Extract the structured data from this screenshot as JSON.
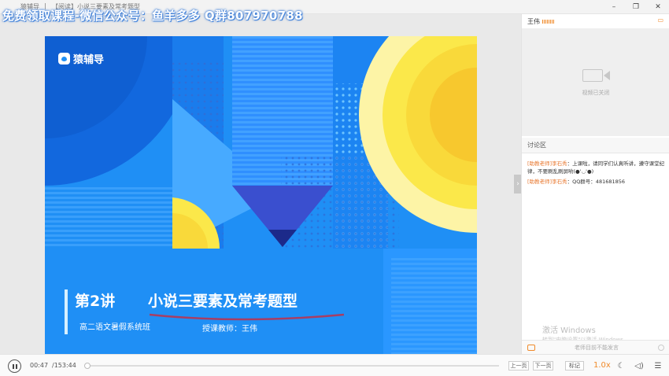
{
  "watermark": {
    "text": "免费领取课程-微信公众号：鱼羊多多 Q群807970788"
  },
  "titlebar": {
    "app_name": "猿辅导",
    "separator": "|",
    "breadcrumb": "【阅读】小说三要素及常考题型",
    "controls": {
      "minimize": "–",
      "maximize": "❐",
      "close": "✕"
    }
  },
  "slide": {
    "logo_text": "猿辅导",
    "lecture_number": "第2讲",
    "lecture_title": "小说三要素及常考题型",
    "course_name": "高二语文暑假系统班",
    "teacher_label": "授课教师：王伟",
    "colors": {
      "background": "#1f8ff5",
      "accent_yellow": "#fbe84a",
      "dark_blue": "#2a3fb8"
    }
  },
  "right_panel": {
    "cam_user": "王伟",
    "cam_status": "视频已关闭",
    "discussion_title": "讨论区",
    "messages": [
      {
        "sender": "[助教老师]李石秀",
        "text": "：上课啦，请同学们认真听讲，遵守课堂纪律，不要刷乱刷屏哟(●'◡'●)"
      },
      {
        "sender": "[助教老师]李石秀",
        "text": "：QQ群号：481681856"
      }
    ],
    "activation_line1": "激活 Windows",
    "activation_line2": "转到\"电脑设置\"以激活 Windows。",
    "chat_input_placeholder": "老师目前不能发言"
  },
  "player": {
    "time_current": "00:47",
    "time_total": "/153:44",
    "progress": 0.005,
    "prev_label": "上一页",
    "next_label": "下一页",
    "mark_label": "标记",
    "speed": "1.0x",
    "accent": "#f08a2a"
  }
}
